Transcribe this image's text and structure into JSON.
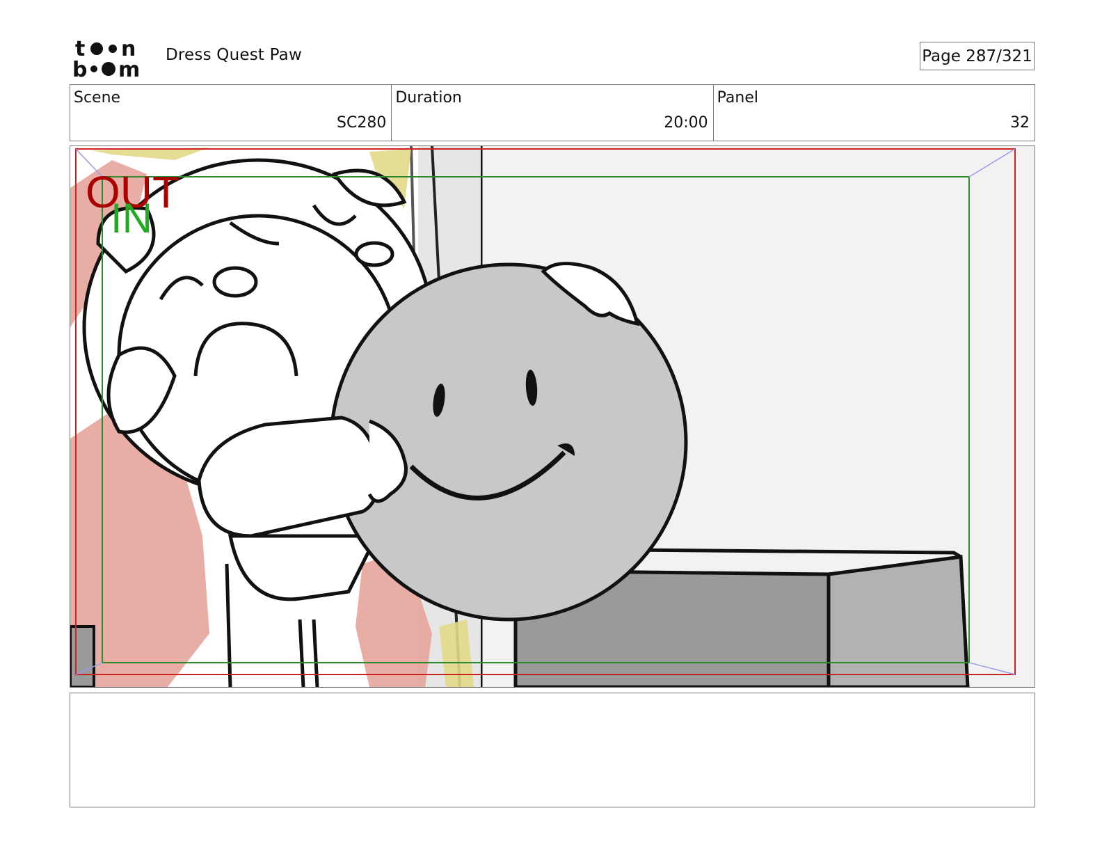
{
  "header": {
    "logo_top": "toon",
    "logo_bottom": "boom",
    "project_title": "Dress Quest Paw",
    "page_label": "Page 287/321"
  },
  "info": {
    "scene_label": "Scene",
    "scene_value": "SC280",
    "duration_label": "Duration",
    "duration_value": "20:00",
    "panel_label": "Panel",
    "panel_value": "32"
  },
  "panel": {
    "out_label": "OUT",
    "in_label": "IN",
    "colors": {
      "out_frame": "#cc2222",
      "in_frame": "#2f8a2f",
      "out_text": "#aa0000",
      "in_text": "#22aa22",
      "smiley_fill": "#c8c8c8",
      "box_dark": "#9a9a9a",
      "box_light": "#b2b2b2",
      "wall": "#f2f2f2",
      "salmon": "#e6a59c",
      "yellow": "#e3d98a"
    }
  },
  "notes": {
    "text": ""
  }
}
